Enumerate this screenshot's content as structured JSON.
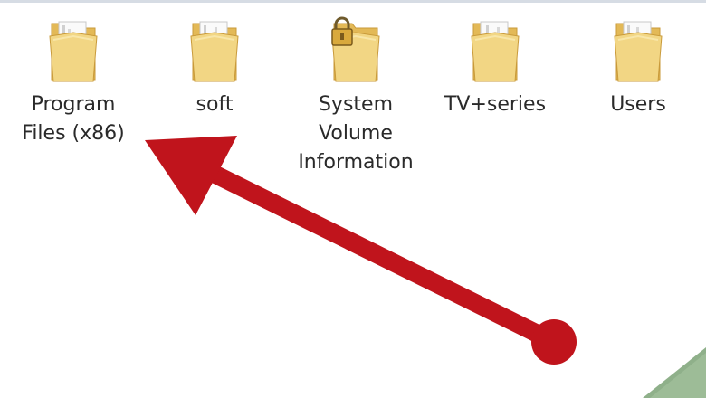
{
  "folders": [
    {
      "label": "Program\nFiles (x86)",
      "locked": false
    },
    {
      "label": "soft",
      "locked": false
    },
    {
      "label": "System\nVolume\nInformation",
      "locked": true
    },
    {
      "label": "TV+series",
      "locked": false
    },
    {
      "label": "Users",
      "locked": false
    }
  ],
  "icons": {
    "folder": "folder-icon",
    "lock": "lock-icon"
  },
  "colors": {
    "folder_front": "#f2d684",
    "folder_back": "#e3b957",
    "folder_edge": "#c99a3a",
    "arrow": "#c0141c",
    "badge": "#8fb08a"
  }
}
